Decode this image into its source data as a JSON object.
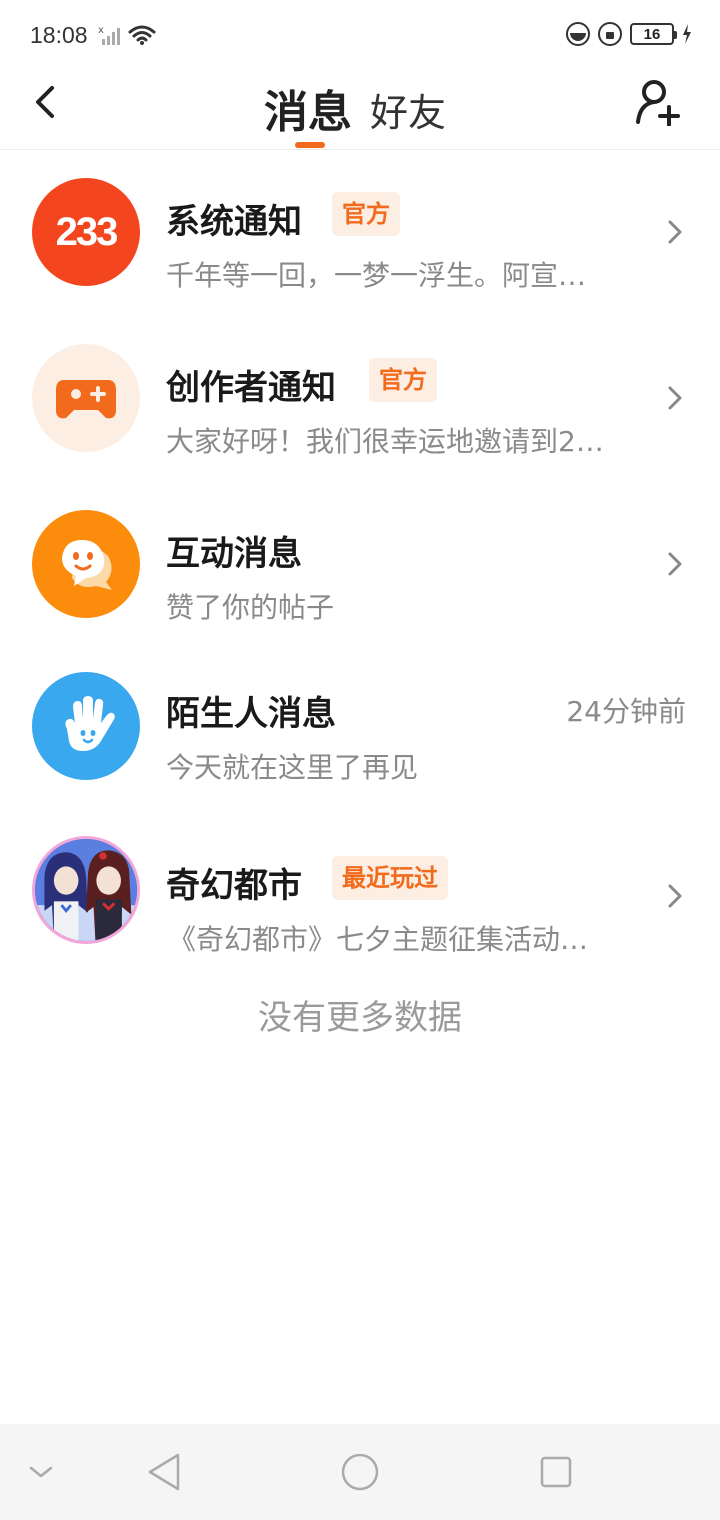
{
  "status_bar": {
    "time": "18:08",
    "battery": "16"
  },
  "header": {
    "tab_messages": "消息",
    "tab_friends": "好友",
    "accent_color": "#f26a1b"
  },
  "messages": [
    {
      "title": "系统通知",
      "badge": "官方",
      "preview": "千年等一回，一梦一浮生。阿宣…",
      "avatar_icon": "233-logo-icon",
      "avatar_text": "233"
    },
    {
      "title": "创作者通知",
      "badge": "官方",
      "preview": "大家好呀！我们很幸运地邀请到2…",
      "avatar_icon": "gamepad-icon"
    },
    {
      "title": "互动消息",
      "preview": "赞了你的帖子",
      "avatar_icon": "chat-bubble-icon"
    },
    {
      "title": "陌生人消息",
      "preview": "今天就在这里了再见",
      "time": "24分钟前",
      "avatar_icon": "waving-hand-icon"
    },
    {
      "title": "奇幻都市",
      "badge": "最近玩过",
      "preview": "《奇幻都市》七夕主题征集活动…",
      "avatar_icon": "game-characters-avatar"
    }
  ],
  "footer": {
    "no_more": "没有更多数据"
  }
}
